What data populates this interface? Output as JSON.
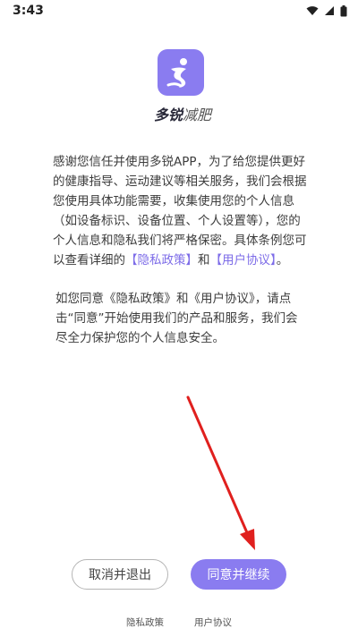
{
  "status_bar": {
    "time": "3:43",
    "icons": [
      "wifi-icon",
      "signal-icon",
      "battery-icon"
    ]
  },
  "brand": {
    "logo_icon": "runner-logo-icon",
    "name_bold": "多锐",
    "name_light": "减肥"
  },
  "intro": {
    "part1": "感谢您信任并使用多锐APP，为了给您提供更好的健康指导、运动建议等相关服务，我们会根据您使用具体功能需要，收集使用您的个人信息（如设备标识、设备位置、个人设置等），您的个人信息和隐私我们将严格保密。具体条例您可以查看详细的",
    "privacy_link": "【隐私政策】",
    "and": "和",
    "terms_link": "【用户协议】",
    "end": "。"
  },
  "consent": {
    "text": "如您同意《隐私政策》和《用户协议》，请点击“同意”开始使用我们的产品和服务，我们会尽全力保护您的个人信息安全。"
  },
  "buttons": {
    "cancel_label": "取消并退出",
    "agree_label": "同意并继续"
  },
  "footer": {
    "privacy_label": "隐私政策",
    "terms_label": "用户协议"
  },
  "colors": {
    "accent": "#8a7cf0",
    "link": "#7d6ce8",
    "annotation_arrow": "#e0201e"
  }
}
